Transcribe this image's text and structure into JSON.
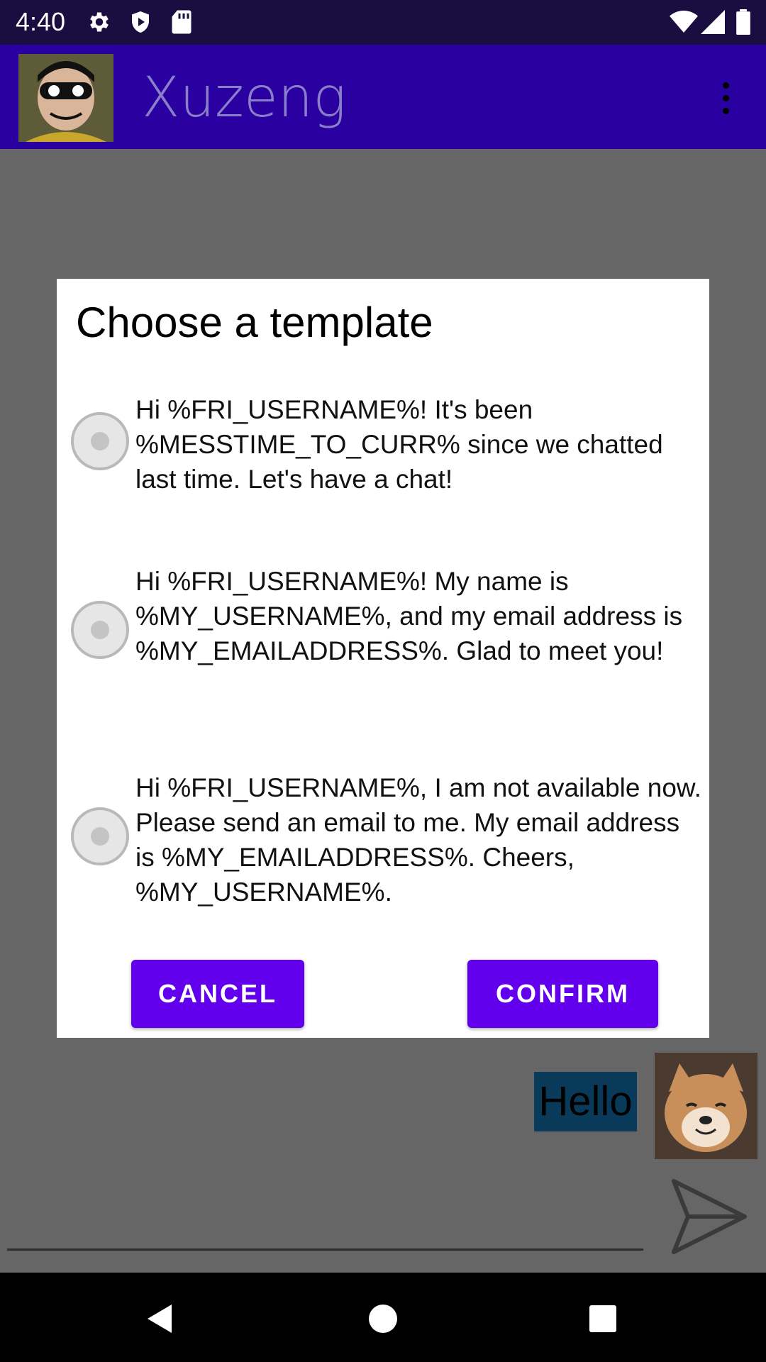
{
  "status_bar": {
    "time": "4:40",
    "icons": [
      "gear-icon",
      "shield-play-icon",
      "sd-card-icon",
      "wifi-icon",
      "signal-icon",
      "battery-icon"
    ]
  },
  "app_bar": {
    "title": "Xuzeng",
    "avatar_icon": "contact-avatar",
    "menu_icon": "more-vert-icon"
  },
  "chat": {
    "message_text": "Hello",
    "send_icon": "send-icon"
  },
  "dialog": {
    "title": "Choose a template",
    "options": [
      {
        "label": "Hi %FRI_USERNAME%! It's been %MESSTIME_TO_CURR% since we chatted last time. Let's have a chat!",
        "selected": false
      },
      {
        "label": "Hi %FRI_USERNAME%! My name is %MY_USERNAME%, and my email address is %MY_EMAILADDRESS%. Glad to meet you!",
        "selected": false
      },
      {
        "label": "Hi %FRI_USERNAME%, I am not available now. Please send an email to me. My email address is %MY_EMAILADDRESS%. Cheers, %MY_USERNAME%.",
        "selected": false
      }
    ],
    "cancel_label": "CANCEL",
    "confirm_label": "CONFIRM"
  },
  "nav_bar": {
    "icons": [
      "back-icon",
      "home-icon",
      "recents-icon"
    ]
  },
  "colors": {
    "status_bar": "#1a0d40",
    "app_bar": "#2b00a0",
    "accent": "#6200ee",
    "scrim": "#666666"
  }
}
